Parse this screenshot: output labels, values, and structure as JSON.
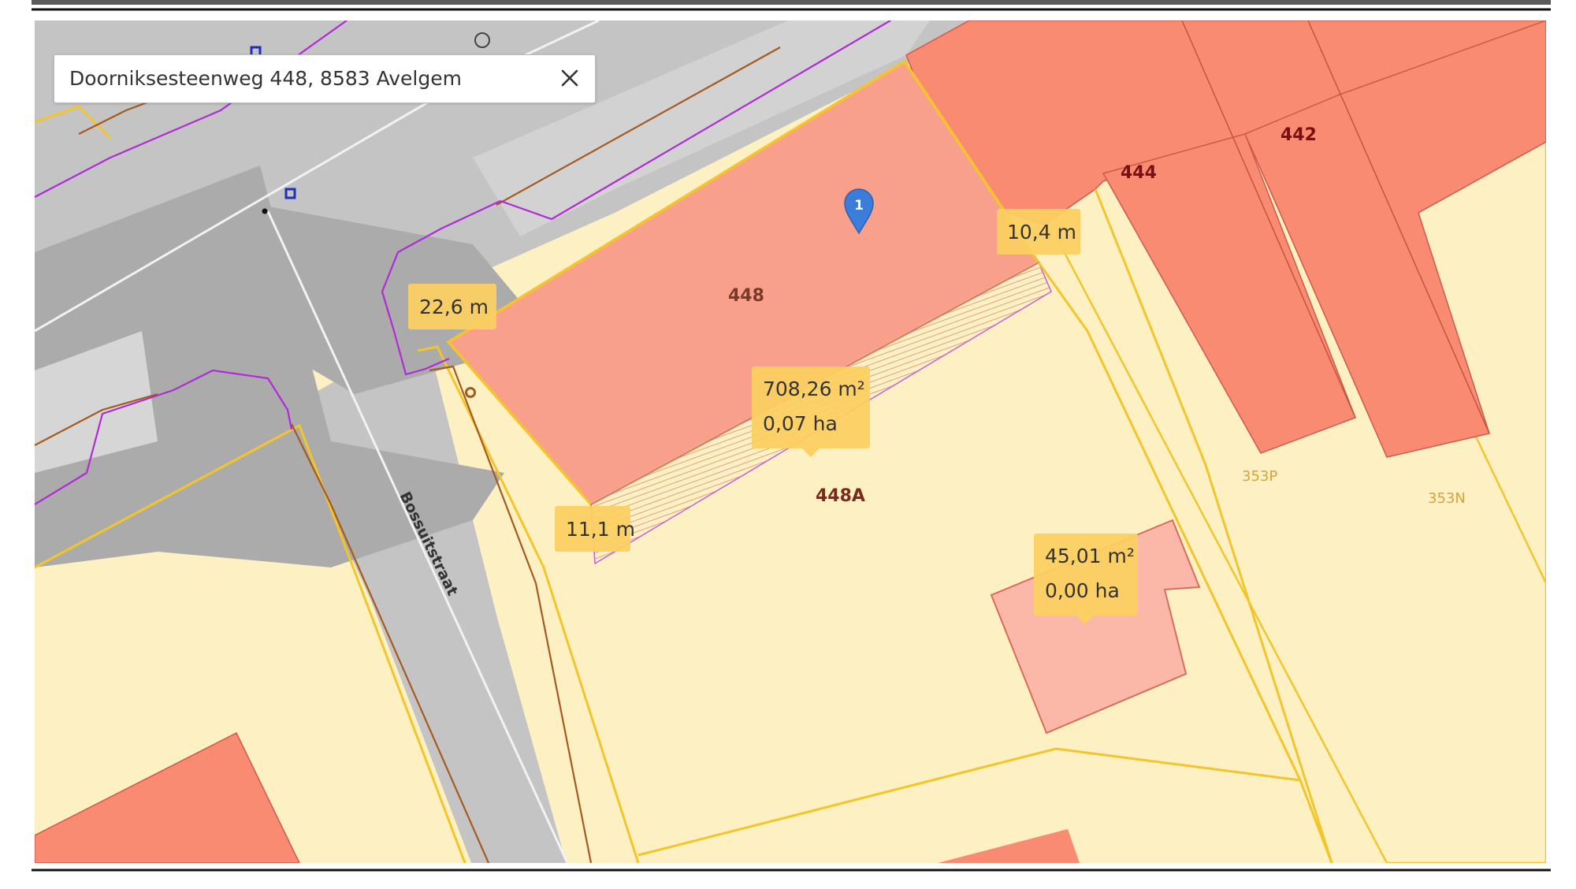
{
  "search": {
    "value": "Doorniksesteenweg 448, 8583 Avelgem",
    "clear_icon": "close-icon"
  },
  "street_label": "Bossuitstraat",
  "parcels": {
    "p448": "448",
    "p448a": "448A",
    "p444": "444",
    "p442": "442",
    "p353p": "353P",
    "p353n": "353N"
  },
  "measurements": {
    "length_a": "22,6 m",
    "length_b": "10,4 m",
    "length_c": "11,1 m",
    "area_1_m2": "708,26 m²",
    "area_1_ha": "0,07 ha",
    "area_2_m2": "45,01 m²",
    "area_2_ha": "0,00 ha"
  },
  "marker": {
    "label": "1",
    "icon": "map-pin-icon",
    "color": "#3b7dd8"
  },
  "colors": {
    "parcel_fill": "#fdf1c4",
    "building_fill": "#f98b73",
    "selected_fill": "#f9a08c",
    "small_building_fill": "#fbb8a8",
    "road_fill": "#c4c4c4",
    "road_dark": "#ababab",
    "parcel_border": "#f3c52b",
    "measurement_box": "#fcd061",
    "boundary_purple": "#b12ad8",
    "boundary_brown": "#a55a1f"
  }
}
